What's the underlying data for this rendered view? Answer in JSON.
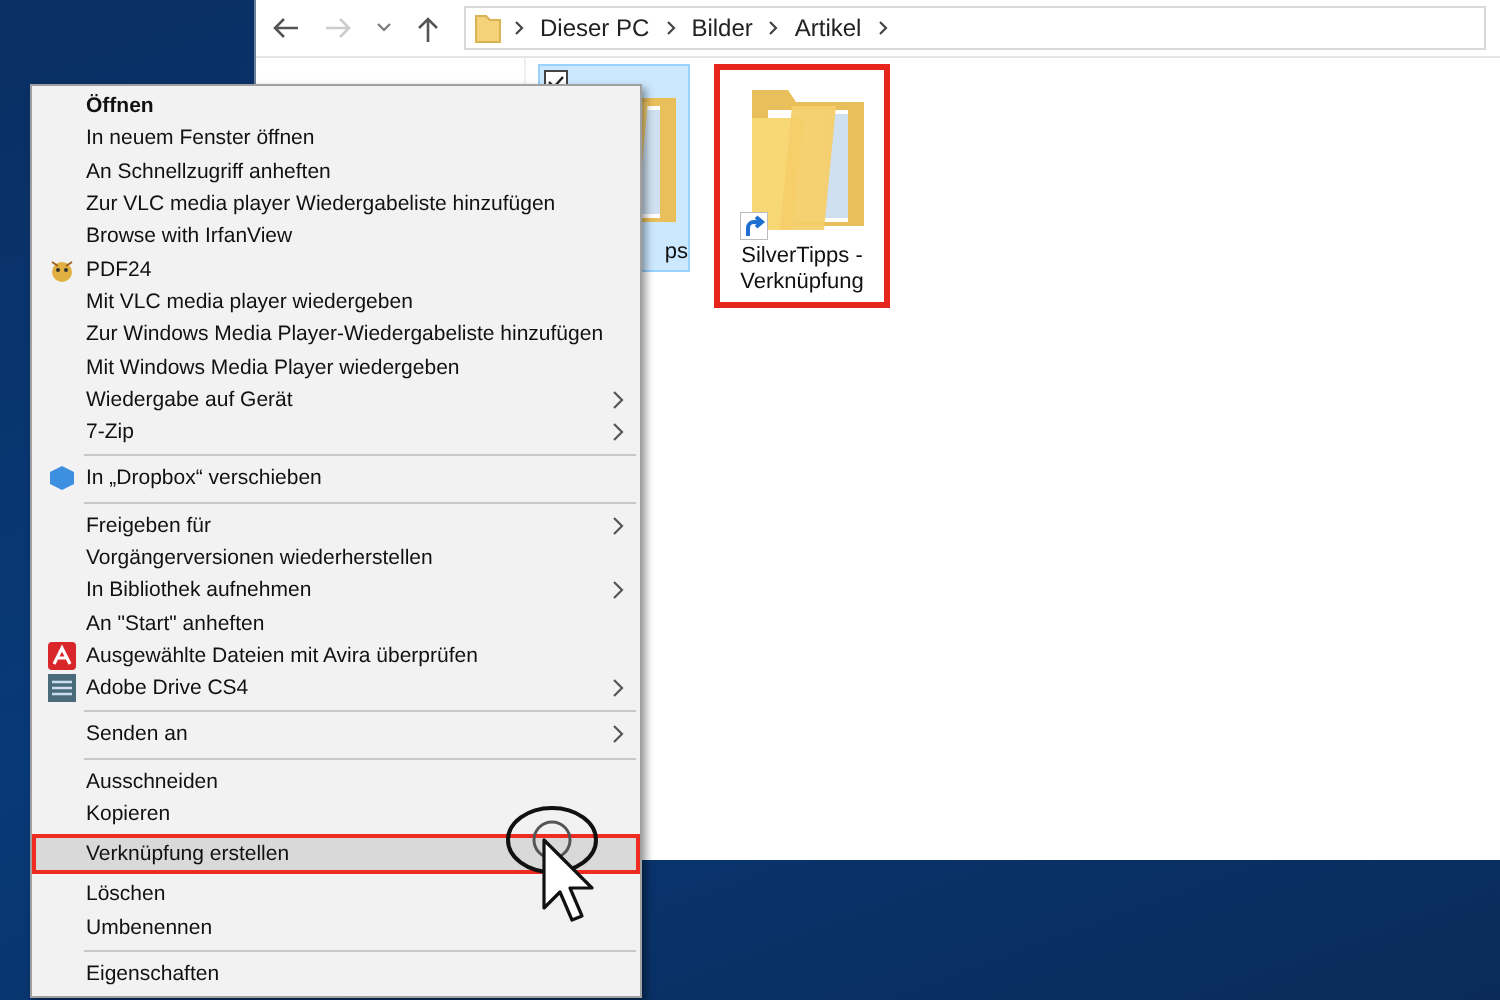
{
  "explorer": {
    "nav": {
      "back_enabled": true,
      "forward_enabled": false
    },
    "breadcrumbs": [
      "Dieser PC",
      "Bilder",
      "Artikel"
    ],
    "items": [
      {
        "label": "ps",
        "selected": true,
        "checked": true,
        "marked": false
      },
      {
        "label": "SilverTipps - Verknüpfung",
        "selected": false,
        "checked": false,
        "marked": true,
        "shortcut": true
      }
    ]
  },
  "context_menu": {
    "groups": [
      {
        "items": [
          {
            "label": "Öffnen",
            "default": true,
            "selected": false,
            "submenu": false
          },
          {
            "label": "In neuem Fenster öffnen",
            "default": false,
            "selected": false,
            "submenu": false
          },
          {
            "label": "An Schnellzugriff anheften",
            "default": false,
            "selected": false,
            "submenu": false
          },
          {
            "label": "Zur VLC media player Wiedergabeliste hinzufügen",
            "default": false,
            "selected": false,
            "submenu": false
          },
          {
            "label": "Browse with IrfanView",
            "default": false,
            "selected": false,
            "submenu": false
          },
          {
            "label": "PDF24",
            "default": false,
            "selected": false,
            "submenu": false,
            "kind": "bee"
          },
          {
            "label": "Mit VLC media player wiedergeben",
            "default": false,
            "selected": false,
            "submenu": false
          },
          {
            "label": "Zur Windows Media Player-Wiedergabeliste hinzufügen",
            "default": false,
            "selected": false,
            "submenu": false
          },
          {
            "label": "Mit Windows Media Player wiedergeben",
            "default": false,
            "selected": false,
            "submenu": false
          },
          {
            "label": "Wiedergabe auf Gerät",
            "default": false,
            "selected": false,
            "submenu": true
          },
          {
            "label": "7-Zip",
            "default": false,
            "selected": false,
            "submenu": true
          }
        ]
      },
      {
        "items": [
          {
            "label": "In „Dropbox“ verschieben",
            "default": false,
            "selected": false,
            "submenu": false,
            "kind": "dropbox"
          }
        ]
      },
      {
        "items": [
          {
            "label": "Freigeben für",
            "default": false,
            "selected": false,
            "submenu": true
          },
          {
            "label": "Vorgängerversionen wiederherstellen",
            "default": false,
            "selected": false,
            "submenu": false
          },
          {
            "label": "In Bibliothek aufnehmen",
            "default": false,
            "selected": false,
            "submenu": true
          },
          {
            "label": "An \"Start\" anheften",
            "default": false,
            "selected": false,
            "submenu": false
          },
          {
            "label": "Ausgewählte Dateien mit Avira überprüfen",
            "default": false,
            "selected": false,
            "submenu": false,
            "kind": "umbrella"
          },
          {
            "label": "Adobe Drive CS4",
            "default": false,
            "selected": false,
            "submenu": true,
            "kind": "drive"
          }
        ]
      },
      {
        "items": [
          {
            "label": "Senden an",
            "default": false,
            "selected": false,
            "submenu": true
          }
        ]
      },
      {
        "items": [
          {
            "label": "Ausschneiden",
            "default": false,
            "selected": false,
            "submenu": false
          },
          {
            "label": "Kopieren",
            "default": false,
            "selected": false,
            "submenu": false
          },
          {
            "label": "Verknüpfung erstellen",
            "default": false,
            "selected": true,
            "submenu": false
          },
          {
            "label": "Löschen",
            "default": false,
            "selected": false,
            "submenu": false
          },
          {
            "label": "Umbenennen",
            "default": false,
            "selected": false,
            "submenu": false
          }
        ]
      },
      {
        "items": [
          {
            "label": "Eigenschaften",
            "default": false,
            "selected": false,
            "submenu": false
          }
        ]
      }
    ]
  }
}
